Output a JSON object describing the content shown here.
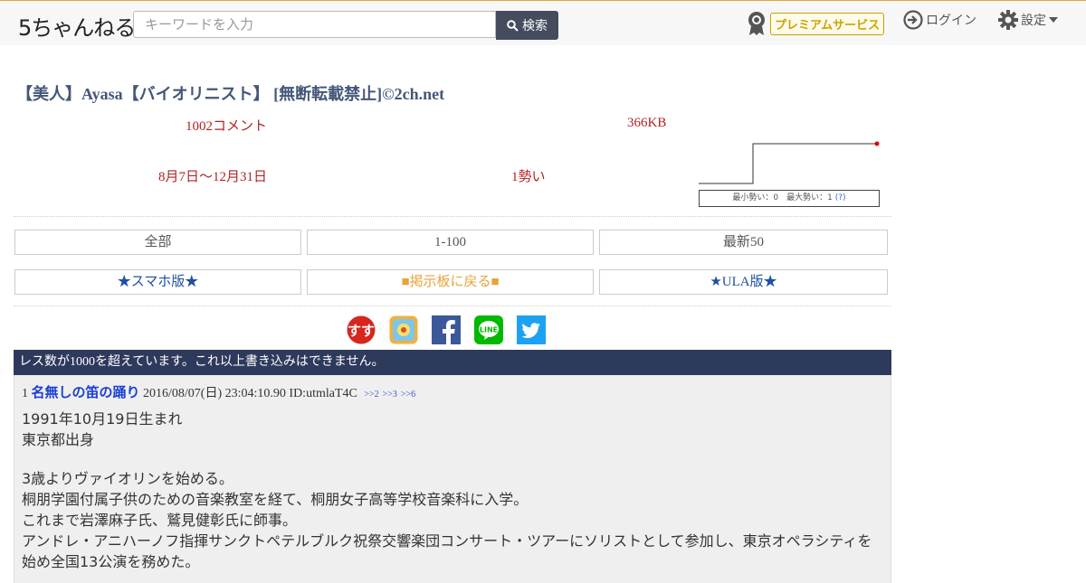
{
  "header": {
    "logo_text": "5ちゃんねる",
    "search_placeholder": "キーワードを入力",
    "search_button": "検索",
    "premium_label": "プレミアムサービス",
    "login_label": "ログイン",
    "settings_label": "設定"
  },
  "thread": {
    "title": "【美人】Ayasa【バイオリニスト】 [無断転載禁止]©2ch.net",
    "comments": "1002コメント",
    "size": "366KB",
    "period": "8月7日〜12月31日",
    "momentum": "1勢い",
    "graph_legend": "最小勢い：0　最大勢い：1",
    "graph_help": "(?)"
  },
  "nav": {
    "all": "全部",
    "first100": "1-100",
    "latest50": "最新50",
    "smartphone": "★スマホ版★",
    "back_to_board": "■掲示板に戻る■",
    "ula": "★ULA版★"
  },
  "share_icons": [
    "susu-icon",
    "app-icon",
    "facebook-icon",
    "line-icon",
    "twitter-icon"
  ],
  "colors": {
    "accent": "#e8a33a",
    "title": "#44577a",
    "stat": "#b22222",
    "notice_bg": "#2e3a5c",
    "post_name": "#1a3fd6"
  },
  "notice": "レス数が1000を超えています。これ以上書き込みはできません。",
  "post": {
    "number": "1",
    "name": "名無しの笛の踊り",
    "date": "2016/08/07(日) 23:04:10.90",
    "id": "ID:utmlaT4C",
    "replies": [
      ">>2",
      ">>3",
      ">>6"
    ],
    "lines": [
      "1991年10月19日生まれ",
      "東京都出身",
      "",
      "3歳よりヴァイオリンを始める。",
      "桐朋学園付属子供のための音楽教室を経て、桐朋女子高等学校音楽科に入学。",
      "これまで岩澤麻子氏、鷲見健彰氏に師事。",
      "アンドレ・アニハーノフ指揮サンクトペテルブルク祝祭交響楽団コンサート・ツアーにソリストとして参加し、東京オペラシティを始め全国13公演を務めた。"
    ]
  }
}
